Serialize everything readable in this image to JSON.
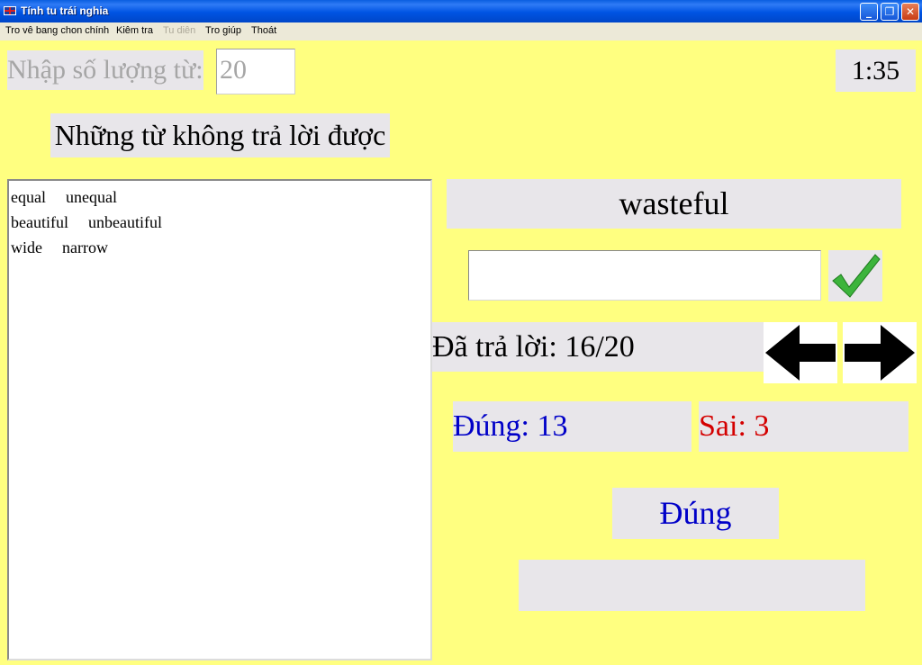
{
  "window": {
    "title": "Tính tu trái nghia",
    "minimize_glyph": "🗕",
    "maximize_glyph": "🗗",
    "close_glyph": "✕",
    "app_icon": "uk-flag-icon"
  },
  "menu": {
    "items": [
      {
        "label": "Tro vê bang chon chính",
        "enabled": true
      },
      {
        "label": "Kiêm tra",
        "enabled": true
      },
      {
        "label": "Tu diên",
        "enabled": false
      },
      {
        "label": "Tro giúp",
        "enabled": true
      },
      {
        "label": "Thoát",
        "enabled": true
      }
    ]
  },
  "settings": {
    "count_label": "Nhập số lượng từ:",
    "count_value": "20"
  },
  "timer": "1:35",
  "unanswered": {
    "title": "Những từ không trả lời được",
    "rows": [
      {
        "word": "equal",
        "antonym": "unequal"
      },
      {
        "word": "beautiful",
        "antonym": "unbeautiful"
      },
      {
        "word": "wide",
        "antonym": "narrow"
      }
    ]
  },
  "quiz": {
    "current_word": "wasteful",
    "answer_value": "",
    "check_icon": "checkmark-icon",
    "progress": "Đã trả lời: 16/20",
    "prev_icon": "arrow-left-icon",
    "next_icon": "arrow-right-icon"
  },
  "score": {
    "correct": "Đúng: 13",
    "wrong": "Sai: 3"
  },
  "result": {
    "label": "Đúng",
    "message": ""
  },
  "colors": {
    "background": "#ffff80",
    "panel": "#e8e6ea",
    "correct": "#0000c8",
    "wrong": "#d40000",
    "check_green": "#3cb43c"
  }
}
